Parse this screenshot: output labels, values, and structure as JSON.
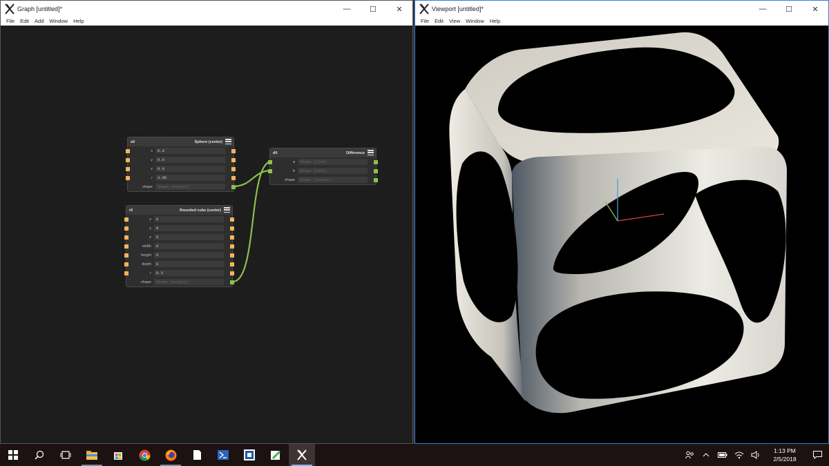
{
  "graph_window": {
    "title": "Graph [untitled]*",
    "menu": [
      "File",
      "Edit",
      "Add",
      "Window",
      "Help"
    ]
  },
  "viewport_window": {
    "title": "Viewport [untitled]*",
    "menu": [
      "File",
      "Edit",
      "View",
      "Window",
      "Help"
    ]
  },
  "window_buttons": {
    "minimize": "—",
    "maximize": "☐",
    "close": "✕"
  },
  "nodes": {
    "sphere": {
      "id": "s0",
      "type": "Sphere (center)",
      "rows": [
        {
          "label": "x",
          "value": "0.0"
        },
        {
          "label": "y",
          "value": "0.0"
        },
        {
          "label": "z",
          "value": "0.0"
        },
        {
          "label": "r",
          "value": "3.85"
        },
        {
          "label": "shape",
          "value": "Shape (output)"
        }
      ]
    },
    "cube": {
      "id": "r0",
      "type": "Rounded cube (center)",
      "rows": [
        {
          "label": "x",
          "value": "0"
        },
        {
          "label": "y",
          "value": "0"
        },
        {
          "label": "z",
          "value": "0"
        },
        {
          "label": "width",
          "value": "6"
        },
        {
          "label": "height",
          "value": "6"
        },
        {
          "label": "depth",
          "value": "6"
        },
        {
          "label": "r",
          "value": "0.3"
        },
        {
          "label": "shape",
          "value": "Shape (output)"
        }
      ]
    },
    "difference": {
      "id": "d0",
      "type": "Difference",
      "rows": [
        {
          "label": "a",
          "value": "Shape (link)"
        },
        {
          "label": "b",
          "value": "Shape (link)"
        },
        {
          "label": "shape",
          "value": "Shape (output)"
        }
      ]
    }
  },
  "colors": {
    "port_input": "#f5b45a",
    "port_output": "#8fbf4e",
    "wire": "#8fbf4e",
    "axis_x": "#d9453b",
    "axis_y": "#8fbf4e",
    "axis_z": "#4a9fe0"
  },
  "taskbar": {
    "icons": [
      "windows-start-icon",
      "search-icon",
      "task-view-icon",
      "file-explorer-icon",
      "store-icon",
      "chrome-icon",
      "firefox-icon",
      "file-icon",
      "powershell-icon",
      "remote-desktop-icon",
      "notepad-icon",
      "studio-app-icon"
    ],
    "clock_time": "1:13 PM",
    "clock_date": "2/5/2018"
  }
}
